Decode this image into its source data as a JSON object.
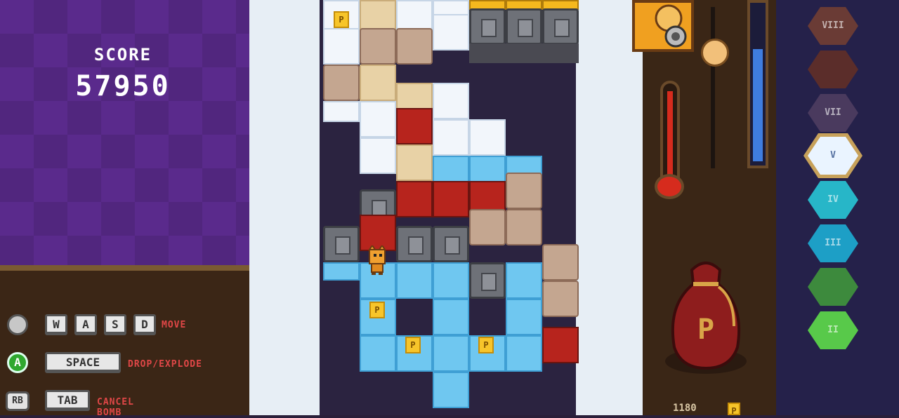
{
  "score": {
    "label": "SCORE",
    "value": "57950"
  },
  "controls": [
    {
      "icon": "dpad",
      "keys": [
        "W",
        "A",
        "S",
        "D"
      ],
      "action": "MOVE"
    },
    {
      "icon": "A",
      "keys": [
        "SPACE"
      ],
      "action": "DROP/EXPLODE"
    },
    {
      "icon": "RB",
      "keys": [
        "TAB"
      ],
      "action": "CANCEL BOMB"
    }
  ],
  "coin_symbol": "P",
  "bag": {
    "amount": "1180"
  },
  "depth_levels": [
    {
      "label": "VIII",
      "color": "#6a3b35"
    },
    {
      "label": "",
      "color": "#5b2d2a"
    },
    {
      "label": "VII",
      "color": "#4a3a5e"
    },
    {
      "label": "V",
      "color": "#eaf4ff"
    },
    {
      "label": "IV",
      "color": "#27b6c8"
    },
    {
      "label": "III",
      "color": "#1d9fc6"
    },
    {
      "label": "",
      "color": "#3d8a3d"
    },
    {
      "label": "II",
      "color": "#58c94a"
    }
  ],
  "colors": {
    "accent_purple": "#5a2a8c",
    "panel_brown": "#3b2616",
    "action_red": "#e04747"
  }
}
